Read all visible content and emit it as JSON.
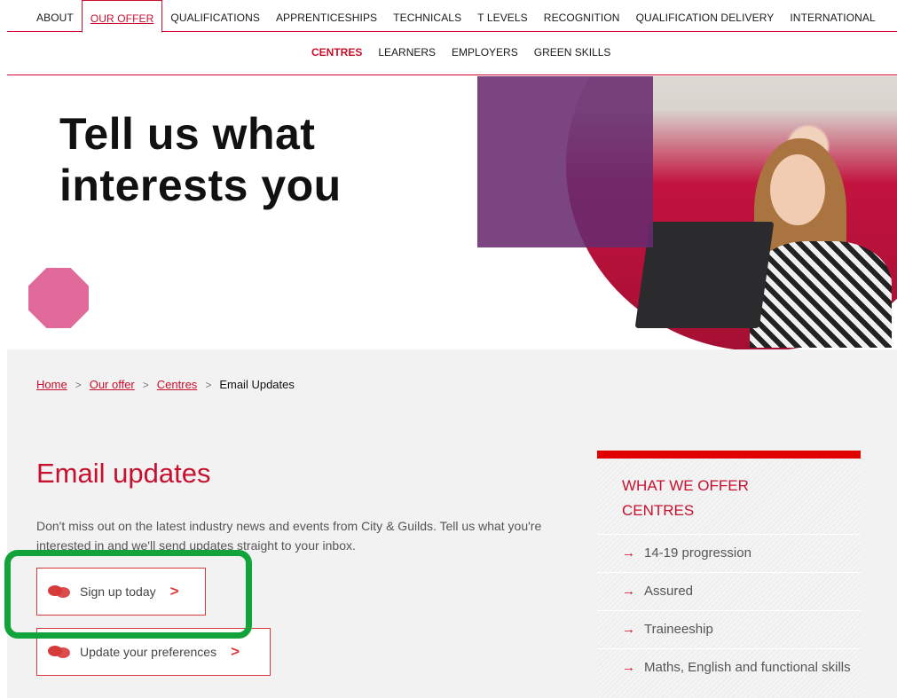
{
  "topnav": {
    "items": [
      "ABOUT",
      "OUR OFFER",
      "QUALIFICATIONS",
      "APPRENTICESHIPS",
      "TECHNICALS",
      "T LEVELS",
      "RECOGNITION",
      "QUALIFICATION DELIVERY",
      "INTERNATIONAL"
    ],
    "active_index": 1
  },
  "subnav": {
    "items": [
      "CENTRES",
      "LEARNERS",
      "EMPLOYERS",
      "GREEN SKILLS"
    ],
    "active_index": 0
  },
  "hero": {
    "title_line1": "Tell us what",
    "title_line2": "interests you"
  },
  "breadcrumb": {
    "home": "Home",
    "our_offer": "Our offer",
    "centres": "Centres",
    "current": "Email Updates",
    "separator": ">"
  },
  "main": {
    "title": "Email updates",
    "intro": "Don't miss out on the latest industry news and events from City & Guilds. Tell us what you're interested in and we'll send updates straight to your inbox.",
    "cta_signup": "Sign up today",
    "cta_preferences": "Update your preferences",
    "chevron": ">"
  },
  "sidebar": {
    "heading_line1": "WHAT WE OFFER",
    "heading_line2": "CENTRES",
    "arrow": "→",
    "items": [
      "14-19 progression",
      "Assured",
      "Traineeship",
      "Maths, English and functional skills"
    ]
  },
  "colors": {
    "brand_red": "#c8102e",
    "highlight_green": "#12a43a",
    "purple": "#682b6e",
    "pink": "#e06b9a"
  }
}
